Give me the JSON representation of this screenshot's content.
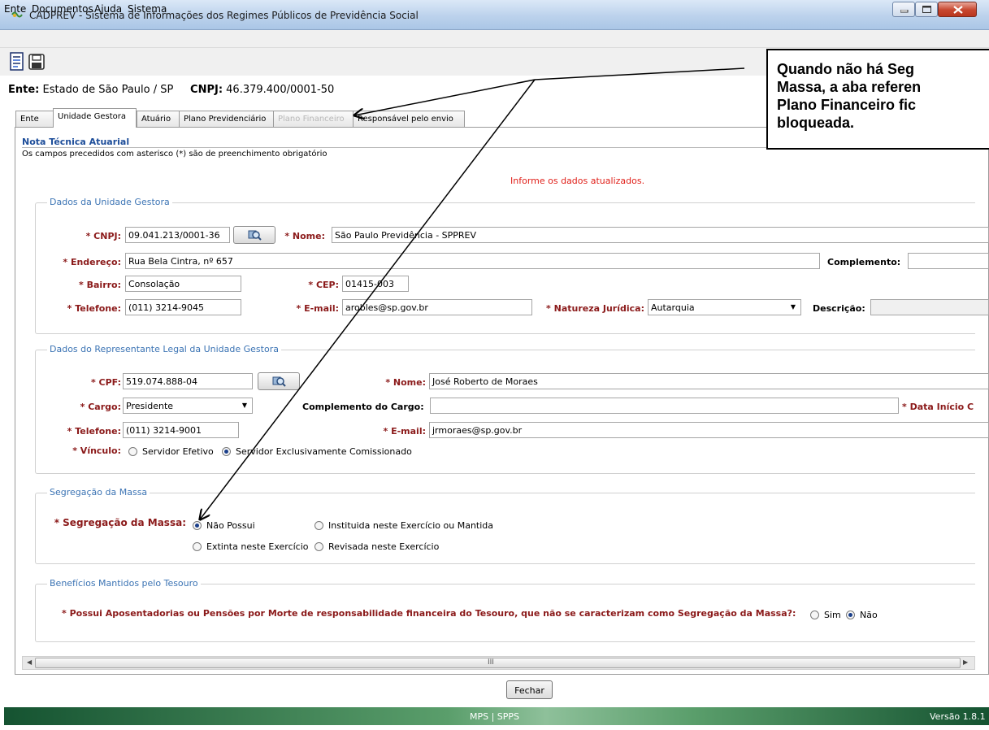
{
  "window": {
    "title": "CADPREV - Sistema de Informações dos Regimes Públicos de Previdência Social"
  },
  "menu": [
    "Ente",
    "Documentos",
    "Ajuda",
    "Sistema"
  ],
  "ente": {
    "label": "Ente:",
    "value": "Estado de São Paulo / SP",
    "cnpj_label": "CNPJ:",
    "cnpj_value": "46.379.400/0001-50"
  },
  "tabs": [
    {
      "label": "Ente",
      "state": "normal"
    },
    {
      "label": "Unidade Gestora",
      "state": "active"
    },
    {
      "label": "Atuário",
      "state": "normal"
    },
    {
      "label": "Plano Previdenciário",
      "state": "normal"
    },
    {
      "label": "Plano Financeiro",
      "state": "disabled"
    },
    {
      "label": "Responsável pelo envio",
      "state": "normal"
    }
  ],
  "nota": {
    "title": "Nota Técnica Atuarial",
    "subtitle": "Os campos precedidos com asterisco (*) são de preenchimento obrigatório",
    "message": "Informe os dados atualizados."
  },
  "unidade": {
    "group_title": "Dados da Unidade Gestora",
    "cnpj_label": "* CNPJ:",
    "cnpj": "09.041.213/0001-36",
    "nome_label": "* Nome:",
    "nome": "São Paulo Previdência - SPPREV",
    "endereco_label": "* Endereço:",
    "endereco": "Rua Bela Cintra, nº 657",
    "complemento_label": "Complemento:",
    "complemento": "",
    "bairro_label": "* Bairro:",
    "bairro": "Consolação",
    "cep_label": "* CEP:",
    "cep": "01415-003",
    "telefone_label": "* Telefone:",
    "telefone": "(011) 3214-9045",
    "email_label": "* E-mail:",
    "email": "arobles@sp.gov.br",
    "natureza_label": "* Natureza Jurídica:",
    "natureza": "Autarquia",
    "descricao_label": "Descrição:",
    "descricao": ""
  },
  "representante": {
    "group_title": "Dados do Representante Legal da Unidade Gestora",
    "cpf_label": "* CPF:",
    "cpf": "519.074.888-04",
    "nome_label": "* Nome:",
    "nome": "José Roberto de Moraes",
    "cargo_label": "* Cargo:",
    "cargo": "Presidente",
    "compl_cargo_label": "Complemento do Cargo:",
    "compl_cargo": "",
    "data_inicio_label": "* Data Início C",
    "telefone_label": "* Telefone:",
    "telefone": "(011) 3214-9001",
    "email_label": "* E-mail:",
    "email": "jrmoraes@sp.gov.br",
    "vinculo_label": "* Vínculo:",
    "vinculo_options": [
      "Servidor Efetivo",
      "Servidor Exclusivamente Comissionado"
    ]
  },
  "segregacao": {
    "group_title": "Segregação da Massa",
    "label": "* Segregação da Massa:",
    "options": [
      "Não Possui",
      "Instituida neste Exercício ou Mantida",
      "Extinta neste Exercício",
      "Revisada neste Exercício"
    ]
  },
  "beneficios": {
    "group_title": "Benefícios Mantidos pelo Tesouro",
    "question": "* Possui Aposentadorias ou Pensões por Morte de responsabilidade financeira do Tesouro, que não se caracterizam como Segregação da Massa?:",
    "options": [
      "Sim",
      "Não"
    ]
  },
  "buttons": {
    "fechar": "Fechar"
  },
  "status": {
    "center": "MPS | SPPS",
    "version": "Versão 1.8.1"
  },
  "annotation": {
    "lines": [
      "Quando não há Seg",
      "Massa, a aba referen",
      "Plano Financeiro fic",
      "bloqueada."
    ]
  },
  "colors": {
    "required_label": "#8b1a1a",
    "group_title": "#3c74b4",
    "message": "#e0201a",
    "status_bar": "#155331"
  }
}
